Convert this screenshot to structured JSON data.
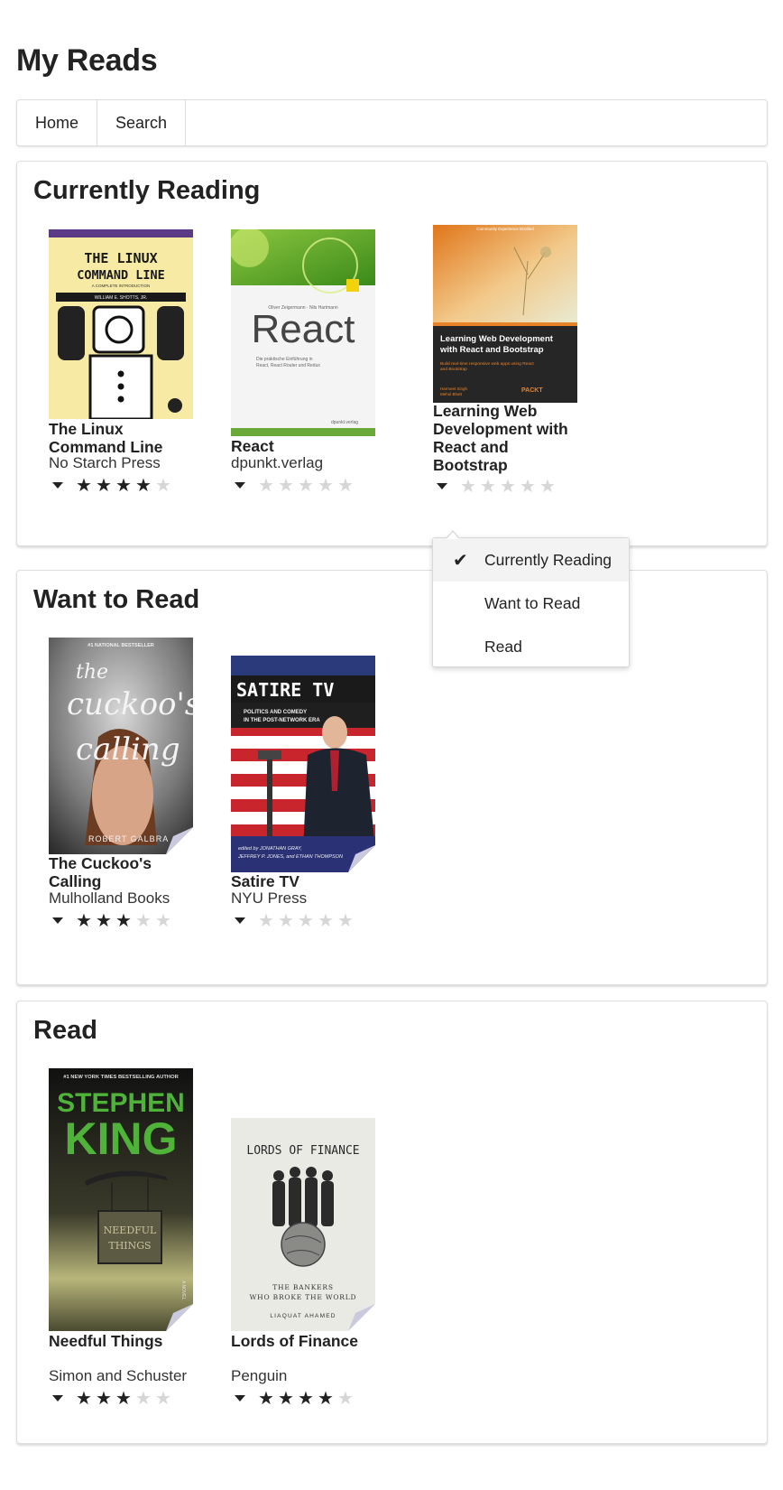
{
  "app": {
    "title": "My Reads"
  },
  "nav": {
    "home": "Home",
    "search": "Search"
  },
  "shelves": [
    {
      "title": "Currently Reading",
      "books": [
        {
          "title": "The Linux Command Line",
          "author": "No Starch Press",
          "rating": 4
        },
        {
          "title": "React",
          "author": "dpunkt.verlag",
          "rating": 0
        },
        {
          "title": "Learning Web Development with React and Bootstrap",
          "author": "",
          "rating": 0
        }
      ]
    },
    {
      "title": "Want to Read",
      "books": [
        {
          "title": "The Cuckoo's Calling",
          "author": "Mulholland Books",
          "rating": 3
        },
        {
          "title": "Satire TV",
          "author": "NYU Press",
          "rating": 0
        }
      ]
    },
    {
      "title": "Read",
      "books": [
        {
          "title": "Needful Things",
          "author": "Simon and Schuster",
          "rating": 3
        },
        {
          "title": "Lords of Finance",
          "author": "Penguin",
          "rating": 4
        }
      ]
    }
  ],
  "covers": {
    "linux": {
      "line1": "THE LINUX",
      "line2": "COMMAND LINE",
      "sub": "A COMPLETE INTRODUCTION",
      "author": "WILLIAM E. SHOTTS, JR."
    },
    "react": {
      "authors": "Oliver Zeigermann · Nils Hartmann",
      "title": "React",
      "sub1": "Die praktische Einführung in",
      "sub2": "React, React Router und Redux",
      "publisher": "dpunkt.verlag"
    },
    "lwd": {
      "banner": "Community Experience Distilled",
      "title1": "Learning Web Development",
      "title2": "with React and Bootstrap",
      "sub1": "Build real-time responsive web apps using React",
      "sub2": "and Bootstrap",
      "author1": "Harmeet Singh",
      "author2": "Mehul Bhatt",
      "publisher": "PACKT"
    },
    "cuckoo": {
      "top": "#1 NATIONAL BESTSELLER",
      "title1": "the",
      "title2": "cuckoo's",
      "title3": "calling",
      "author": "ROBERT GALBRA"
    },
    "satire": {
      "title": "SATIRE TV",
      "sub1": "POLITICS AND COMEDY",
      "sub2": "IN THE POST-NETWORK ERA",
      "eds1": "edited by JONATHAN GRAY,",
      "eds2": "JEFFREY P. JONES, and ETHAN THOMPSON"
    },
    "king": {
      "top": "#1 NEW YORK TIMES BESTSELLING AUTHOR",
      "line1": "STEPHEN",
      "line2": "KING",
      "sign1": "NEEDFUL",
      "sign2": "THINGS",
      "side": "A NOVEL"
    },
    "finance": {
      "title": "LORDS OF FINANCE",
      "sub1": "THE BANKERS",
      "sub2": "WHO BROKE THE WORLD",
      "author": "LIAQUAT AHAMED"
    }
  },
  "dropdown": {
    "items": [
      {
        "label": "Currently Reading",
        "checked": true
      },
      {
        "label": "Want to Read",
        "checked": false
      },
      {
        "label": "Read",
        "checked": false
      }
    ]
  },
  "colors": {
    "star_on": "#222222",
    "star_off": "#d6d6d6",
    "border": "#dddddd"
  }
}
